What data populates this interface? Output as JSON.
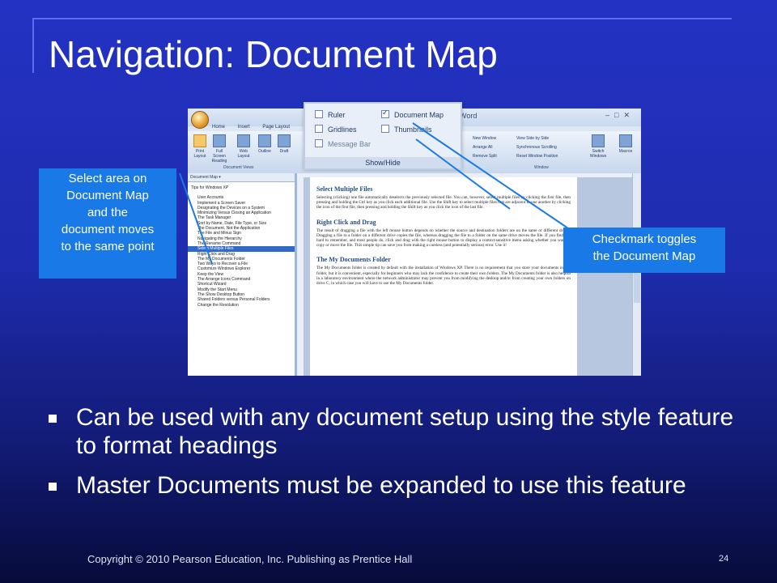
{
  "slide": {
    "title": "Navigation: Document Map",
    "bullets": [
      "Can be used with any document setup using the style feature to format headings",
      "Master Documents must be expanded to use this feature"
    ],
    "footer": "Copyright © 2010 Pearson Education, Inc.  Publishing as Prentice Hall",
    "page_number": "24"
  },
  "callouts": {
    "left": [
      "Select area on",
      "Document Map",
      "and the",
      "document moves",
      "to the same point"
    ],
    "right": [
      "Checkmark toggles",
      "the Document Map"
    ]
  },
  "screenshot": {
    "window_title": "Word",
    "tabs": [
      "Home",
      "Insert",
      "Page Layout"
    ],
    "view_buttons": [
      "Print Layout",
      "Full Screen Reading",
      "Web Layout",
      "Outline",
      "Draft"
    ],
    "group_document_views": "Document Views",
    "group_window": "Window",
    "window_items": [
      "New Window",
      "Arrange All",
      "Remove Split"
    ],
    "window_items2": [
      "View Side by Side",
      "Synchronous Scrolling",
      "Reset Window Position"
    ],
    "switch_windows": "Switch Windows",
    "macros": "Macros",
    "show_hide": {
      "items": [
        {
          "label": "Ruler",
          "checked": false
        },
        {
          "label": "Document Map",
          "checked": true
        },
        {
          "label": "Gridlines",
          "checked": false
        },
        {
          "label": "Thumbnails",
          "checked": false
        },
        {
          "label": "Message Bar",
          "checked": false
        }
      ],
      "group_label": "Show/Hide"
    },
    "document_map": {
      "header": "Document Map",
      "top_item": "Tips for Windows XP",
      "items": [
        "User Accounts",
        "Implement a Screen Saver",
        "Designating the Devices on a System",
        "Minimizing Versus Closing an Application",
        "The Task Manager",
        "Sort by Name, Date, File Type, or Size",
        "The Document, Not the Application",
        "The File and Minus Sign",
        "Navigating the Hierarchy",
        "The Rename Command",
        "Select Multiple Files",
        "Right Click and Drag",
        "The My Documents Folder",
        "Two Ways to Recover a File",
        "Customize Windows Explorer",
        "Keep the View",
        "The Arrange Icons Command",
        "Shortcut Wizard",
        "Modify the Start Menu",
        "The Show Desktop Button",
        "Shared Folders versus Personal Folders",
        "Change the Resolution"
      ],
      "selected_index": 10
    },
    "document": {
      "sections": [
        {
          "heading": "Select Multiple Files",
          "body": "Selecting (clicking) one file automatically deselects the previously selected file. You can, however, select multiple files by clicking the first file, then pressing and holding the Ctrl key as you click each additional file. Use the Shift key to select multiple files that are adjacent to one another by clicking the icon of the first file, then pressing and holding the Shift key as you click the icon of the last file."
        },
        {
          "heading": "Right Click and Drag",
          "body": "The result of dragging a file with the left mouse button depends on whether the source and destination folders are on the same or different drives. Dragging a file to a folder on a different drive copies the file, whereas dragging the file to a folder on the same drive moves the file. If you find this hard to remember, and most people do, click and drag with the right mouse button to display a context-sensitive menu asking whether you want to copy or move the file. This simple tip can save you from making a careless (and potentially serious) error. Use it!"
        },
        {
          "heading": "The My Documents Folder",
          "body": "The My Documents folder is created by default with the installation of Windows XP. There is no requirement that you store your documents in this folder, but it is convenient, especially for beginners who may lack the confidence to create their own folders. The My Documents folder is also helpful in a laboratory environment where the network administrator may prevent you from modifying the desktop and/or from creating your own folders on drive C, in which case you will have to use the My Documents folder."
        }
      ]
    }
  }
}
